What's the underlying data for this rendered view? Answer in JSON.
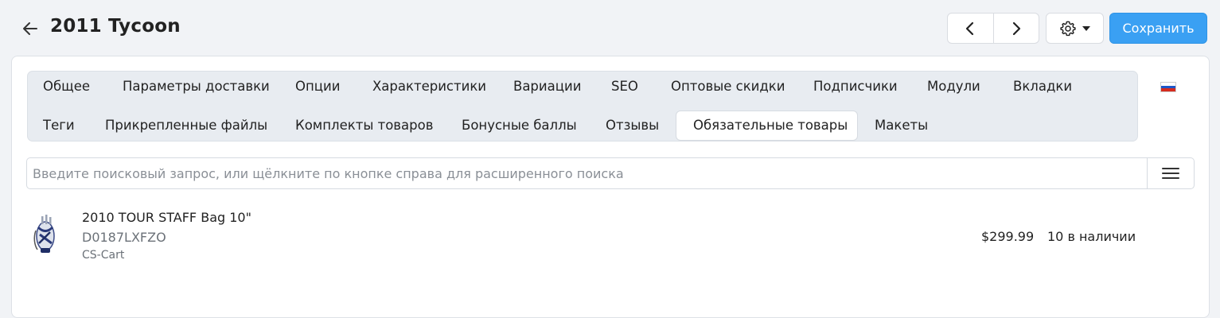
{
  "header": {
    "title": "2011 Tycoon",
    "back_icon": "arrow-left-icon",
    "prev_icon": "chevron-left-icon",
    "next_icon": "chevron-right-icon",
    "settings_icon": "gear-icon",
    "save_label": "Сохранить",
    "accent_color": "#3aa0f3"
  },
  "tabs": {
    "row1": [
      {
        "label": "Общее"
      },
      {
        "label": "Параметры доставки"
      },
      {
        "label": "Опции"
      },
      {
        "label": "Характеристики"
      },
      {
        "label": "Вариации"
      },
      {
        "label": "SEO"
      },
      {
        "label": "Оптовые скидки"
      },
      {
        "label": "Подписчики"
      },
      {
        "label": "Модули"
      },
      {
        "label": "Вкладки"
      }
    ],
    "row2": [
      {
        "label": "Теги"
      },
      {
        "label": "Прикрепленные файлы"
      },
      {
        "label": "Комплекты товаров"
      },
      {
        "label": "Бонусные баллы"
      },
      {
        "label": "Отзывы"
      },
      {
        "label": "Обязательные товары",
        "active": true
      },
      {
        "label": "Макеты"
      }
    ],
    "language_icon": "russian-flag-icon"
  },
  "search": {
    "placeholder": "Введите поисковый запрос, или щёлкните по кнопке справа для расширенного поиска",
    "value": "",
    "advanced_icon": "hamburger-menu-icon"
  },
  "products": [
    {
      "name": "2010 TOUR STAFF Bag 10\"",
      "code": "D0187LXFZO",
      "vendor": "CS-Cart",
      "price": "$299.99",
      "stock": "10 в наличии",
      "thumbnail_icon": "golf-bag-image"
    }
  ]
}
